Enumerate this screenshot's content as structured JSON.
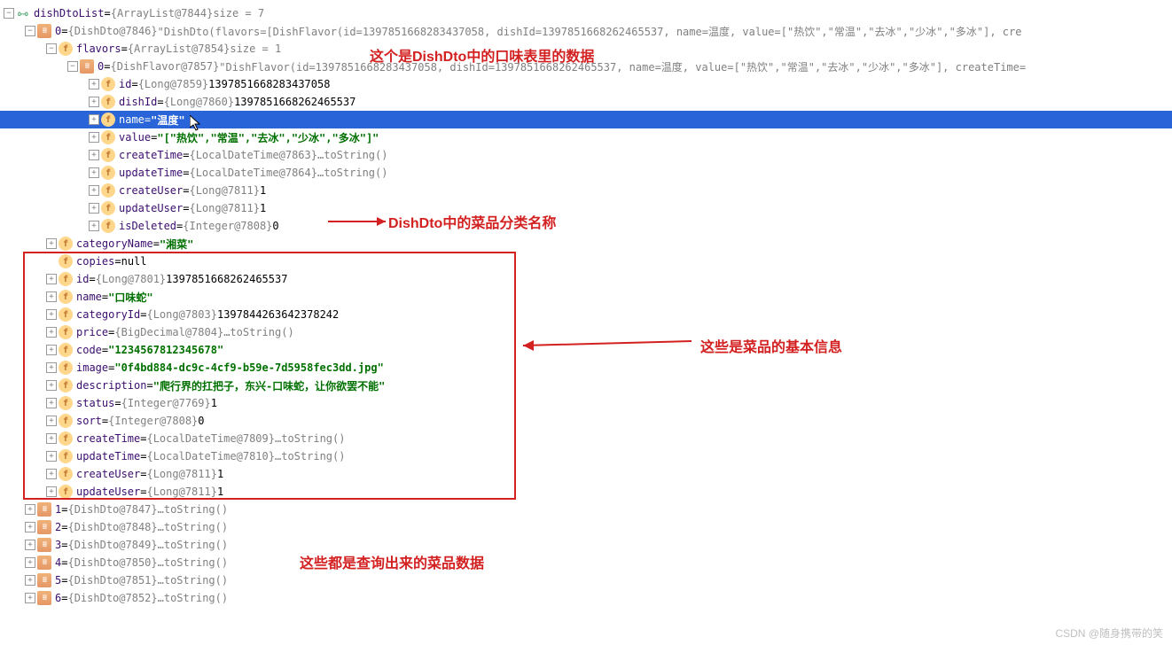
{
  "root": {
    "name": "dishDtoList",
    "ref": "{ArrayList@7844}",
    "size": " size = 7"
  },
  "item0": {
    "name": "0",
    "ref": "{DishDto@7846}",
    "val": "\"DishDto(flavors=[DishFlavor(id=1397851668283437058, dishId=1397851668262465537, name=温度, value=[\"热饮\",\"常温\",\"去冰\",\"少冰\",\"多冰\"], cre"
  },
  "flavors": {
    "name": "flavors",
    "ref": "{ArrayList@7854}",
    "size": " size = 1"
  },
  "flavor0": {
    "name": "0",
    "ref": "{DishFlavor@7857}",
    "val": "\"DishFlavor(id=1397851668283437058, dishId=1397851668262465537, name=温度, value=[\"热饮\",\"常温\",\"去冰\",\"少冰\",\"多冰\"], createTime="
  },
  "f_id": {
    "name": "id",
    "ref": "{Long@7859}",
    "val": "1397851668283437058"
  },
  "f_dishId": {
    "name": "dishId",
    "ref": "{Long@7860}",
    "val": "1397851668262465537"
  },
  "f_name": {
    "name": "name",
    "val": "\"温度\""
  },
  "f_value": {
    "name": "value",
    "val": "\"[\"热饮\",\"常温\",\"去冰\",\"少冰\",\"多冰\"]\""
  },
  "f_createTime": {
    "name": "createTime",
    "ref": "{LocalDateTime@7863}",
    "method": "toString()"
  },
  "f_updateTime": {
    "name": "updateTime",
    "ref": "{LocalDateTime@7864}",
    "method": "toString()"
  },
  "f_createUser": {
    "name": "createUser",
    "ref": "{Long@7811}",
    "val": "1"
  },
  "f_updateUser": {
    "name": "updateUser",
    "ref": "{Long@7811}",
    "val": "1"
  },
  "f_isDeleted": {
    "name": "isDeleted",
    "ref": "{Integer@7808}",
    "val": "0"
  },
  "d_categoryName": {
    "name": "categoryName",
    "val": "\"湘菜\""
  },
  "d_copies": {
    "name": "copies",
    "val": "null"
  },
  "d_id": {
    "name": "id",
    "ref": "{Long@7801}",
    "val": "1397851668262465537"
  },
  "d_name": {
    "name": "name",
    "val": "\"口味蛇\""
  },
  "d_categoryId": {
    "name": "categoryId",
    "ref": "{Long@7803}",
    "val": "1397844263642378242"
  },
  "d_price": {
    "name": "price",
    "ref": "{BigDecimal@7804}",
    "method": "toString()"
  },
  "d_code": {
    "name": "code",
    "val": "\"1234567812345678\""
  },
  "d_image": {
    "name": "image",
    "val": "\"0f4bd884-dc9c-4cf9-b59e-7d5958fec3dd.jpg\""
  },
  "d_description": {
    "name": "description",
    "val": "\"爬行界的扛把子，东兴-口味蛇，让你欲罢不能\""
  },
  "d_status": {
    "name": "status",
    "ref": "{Integer@7769}",
    "val": "1"
  },
  "d_sort": {
    "name": "sort",
    "ref": "{Integer@7808}",
    "val": "0"
  },
  "d_createTime": {
    "name": "createTime",
    "ref": "{LocalDateTime@7809}",
    "method": "toString()"
  },
  "d_updateTime": {
    "name": "updateTime",
    "ref": "{LocalDateTime@7810}",
    "method": "toString()"
  },
  "d_createUser": {
    "name": "createUser",
    "ref": "{Long@7811}",
    "val": "1"
  },
  "d_updateUser": {
    "name": "updateUser",
    "ref": "{Long@7811}",
    "val": "1"
  },
  "item1": {
    "name": "1",
    "ref": "{DishDto@7847}",
    "method": "toString()"
  },
  "item2": {
    "name": "2",
    "ref": "{DishDto@7848}",
    "method": "toString()"
  },
  "item3": {
    "name": "3",
    "ref": "{DishDto@7849}",
    "method": "toString()"
  },
  "item4": {
    "name": "4",
    "ref": "{DishDto@7850}",
    "method": "toString()"
  },
  "item5": {
    "name": "5",
    "ref": "{DishDto@7851}",
    "method": "toString()"
  },
  "item6": {
    "name": "6",
    "ref": "{DishDto@7852}",
    "method": "toString()"
  },
  "annotation1": "这个是DishDto中的口味表里的数据",
  "annotation2": "DishDto中的菜品分类名称",
  "annotation3": "这些是菜品的基本信息",
  "annotation4": "这些都是查询出来的菜品数据",
  "watermark": "CSDN @随身携带的笑"
}
